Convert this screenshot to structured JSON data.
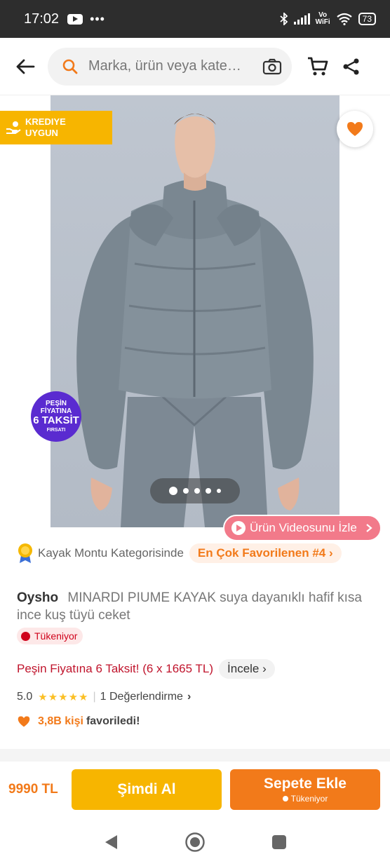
{
  "status": {
    "time": "17:02",
    "dots": "•••",
    "vowifi_top": "Vo",
    "vowifi_bottom": "WiFi",
    "battery": "73"
  },
  "header": {
    "search_placeholder": "Marka, ürün veya kategori ara"
  },
  "gallery": {
    "kredi_line1": "KREDIYE",
    "kredi_line2": "UYGUN",
    "pesin_line1": "PEŞİN",
    "pesin_line2": "FİYATINA",
    "pesin_line3": "6 TAKSİT",
    "pesin_line4": "FIRSATI",
    "video_label": "Ürün Videosunu İzle",
    "image_count": 5,
    "active_image": 1
  },
  "product": {
    "rank_text": "Kayak Montu Kategorisinde",
    "rank_pill": "En Çok Favorilenen #4",
    "brand": "Oysho",
    "name": "MINARDI PIUME KAYAK suya dayanıklı hafif kısa ince kuş tüyü ceket",
    "stock_badge": "Tükeniyor",
    "installment_text": "Peşin Fiyatına 6 Taksit! (6 x 1665 TL)",
    "installment_link": "İncele",
    "rating_value": "5.0",
    "rating_stars": 5,
    "reviews_text": "1 Değerlendirme",
    "fav_count": "3,8B kişi",
    "fav_text": "favoriledi!"
  },
  "footer": {
    "price": "9990 TL",
    "buy_now": "Şimdi Al",
    "add_to_cart": "Sepete Ekle",
    "add_to_cart_sub": "Tükeniyor"
  },
  "colors": {
    "brand_orange": "#f27a1a",
    "buy_yellow": "#f7b500",
    "stock_red": "#d0021b"
  }
}
